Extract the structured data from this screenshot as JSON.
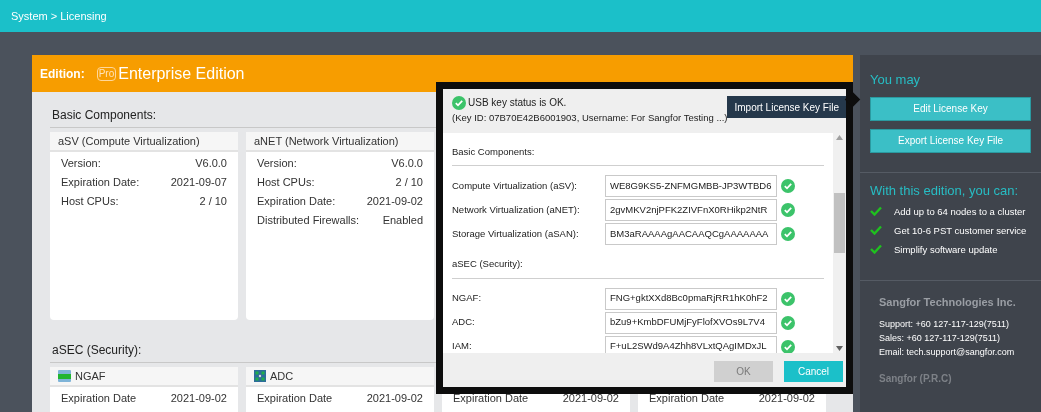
{
  "breadcrumb": "System > Licensing",
  "edition": {
    "label": "Edition:",
    "badge": "Pro",
    "name": "Enterprise Edition"
  },
  "sections": [
    {
      "title": "Basic Components:",
      "cards": [
        {
          "title": "aSV (Compute Virtualization)",
          "rows": [
            {
              "label": "Version:",
              "value": "V6.0.0"
            },
            {
              "label": "Expiration Date:",
              "value": "2021-09-07"
            },
            {
              "label": "Host CPUs:",
              "value": "2 / 10"
            }
          ]
        },
        {
          "title": "aNET (Network Virtualization)",
          "rows": [
            {
              "label": "Version:",
              "value": "V6.0.0"
            },
            {
              "label": "Host CPUs:",
              "value": "2 / 10"
            },
            {
              "label": "Expiration Date:",
              "value": "2021-09-02"
            },
            {
              "label": "Distributed Firewalls:",
              "value": "Enabled"
            }
          ]
        }
      ]
    },
    {
      "title": "aSEC (Security):",
      "cards": [
        {
          "title": "NGAF",
          "rows": [
            {
              "label": "Expiration Date",
              "value": "2021-09-02"
            }
          ]
        },
        {
          "title": "ADC",
          "rows": [
            {
              "label": "Expiration Date",
              "value": "2021-09-02"
            }
          ]
        },
        {
          "rows": [
            {
              "label": "Expiration Date",
              "value": "2021-09-02"
            }
          ]
        },
        {
          "rows": [
            {
              "label": "Expiration Date",
              "value": "2021-09-02"
            }
          ]
        }
      ]
    }
  ],
  "dialog": {
    "status": "USB key status is OK.",
    "detail": "(Key ID: 07B70E42B6001903, Username: For Sangfor Testing ...)",
    "import_button": "Import License Key File",
    "groups": [
      {
        "title": "Basic Components:",
        "keys": [
          {
            "label": "Compute Virtualization (aSV):",
            "value": "WE8G9KS5-ZNFMGMBB-JP3WTBD6",
            "valid": true
          },
          {
            "label": "Network Virtualization (aNET):",
            "value": "2gvMKV2njPFK2ZIVFnX0RHikp2NtR",
            "valid": true
          },
          {
            "label": "Storage Virtualization (aSAN):",
            "value": "BM3aRAAAAgAACAAQCgAAAAAAA",
            "valid": true
          }
        ]
      },
      {
        "title": "aSEC (Security):",
        "keys": [
          {
            "label": "NGAF:",
            "value": "FNG+gktXXd8Bc0pmaRjRR1hK0hF2",
            "valid": true
          },
          {
            "label": "ADC:",
            "value": "bZu9+KmbDFUMjFyFlofXVOs9L7V4",
            "valid": true
          },
          {
            "label": "IAM:",
            "value": "F+uL2SWd9A4Zhh8VLxtQAgIMDxJL",
            "valid": true
          }
        ]
      }
    ],
    "buttons": [
      {
        "label": "OK",
        "disabled": true
      },
      {
        "label": "Cancel",
        "disabled": false
      }
    ]
  },
  "sidebar": {
    "title": "You may",
    "actions": [
      "Edit License Key",
      "Export License Key File"
    ],
    "features_title": "With this edition, you can:",
    "features": [
      "Add up to 64 nodes to a cluster",
      "Get 10-6 PST customer service",
      "Simplify software update"
    ],
    "company": "Sangfor Technologies Inc.",
    "contacts": [
      "Support: +60 127-117-129(7511)",
      "Sales: +60 127-117-129(7511)",
      "Email: tech.support@sangfor.com"
    ],
    "next_company": "Sangfor (P.R.C)"
  }
}
